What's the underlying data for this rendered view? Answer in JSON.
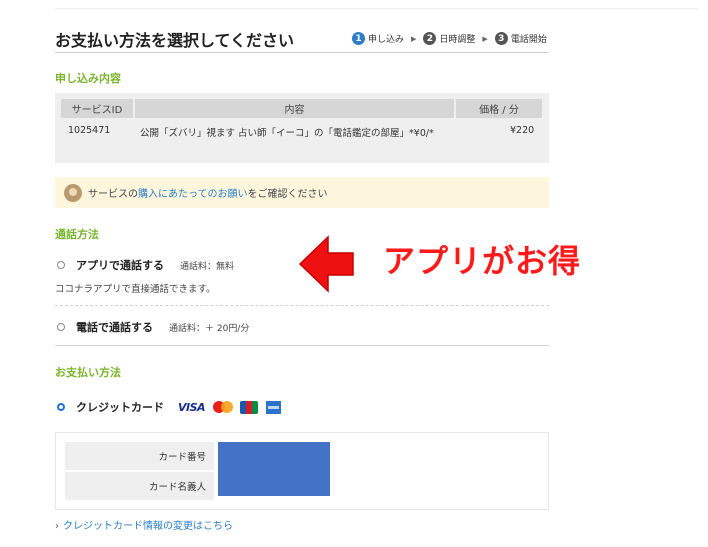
{
  "page": {
    "title": "お支払い方法を選択してください"
  },
  "steps": [
    {
      "num": "1",
      "label": "申し込み"
    },
    {
      "num": "2",
      "label": "日時調整"
    },
    {
      "num": "3",
      "label": "電話開始"
    }
  ],
  "application": {
    "heading": "申し込み内容",
    "columns": [
      "サービスID",
      "内容",
      "価格 / 分"
    ],
    "row": {
      "id": "1025471",
      "content": "公開「ズバリ」視ます 占い師「イーコ」の「電話鑑定の部屋」*¥0/*",
      "price": "¥220"
    }
  },
  "notice": {
    "prefix": "サービスの",
    "link": "購入にあたってのお願い",
    "suffix": "をご確認ください"
  },
  "call_method": {
    "heading": "通話方法",
    "options": [
      {
        "label": "アプリで通話する",
        "fee": "通話料：無料",
        "selected": false
      },
      {
        "label": "電話で通話する",
        "fee": "通話料：＋ 20円/分",
        "selected": false
      }
    ],
    "app_description": "ココナラアプリで直接通話できます。"
  },
  "promo": {
    "text": "アプリがお得",
    "color": "#ff1a1a"
  },
  "payment": {
    "heading": "お支払い方法",
    "option_label": "クレジットカード",
    "selected": true,
    "brands": [
      "VISA",
      "mastercard-icon",
      "jcb-icon",
      "amex-icon"
    ],
    "visa_text": "VISA",
    "fields": [
      {
        "label": "カード番号"
      },
      {
        "label": "カード名義人"
      }
    ],
    "change_link": "クレジットカード情報の変更はこちら"
  },
  "colors": {
    "accent_green": "#7ab32d",
    "link_blue": "#2b7ec7",
    "redacted": "#4472c4"
  }
}
